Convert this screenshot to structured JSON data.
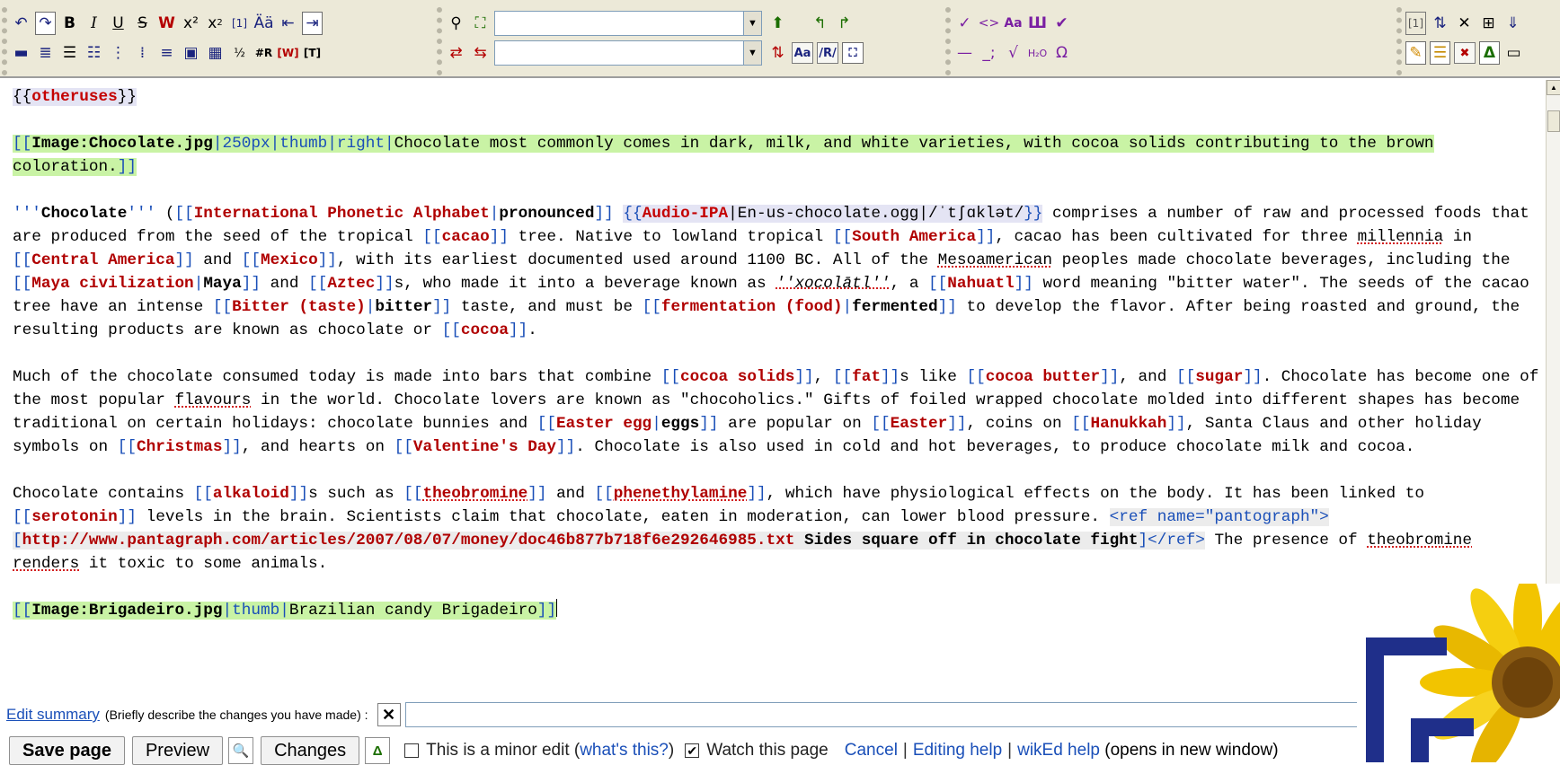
{
  "toolbar": {
    "search_value": "",
    "replace_value": ""
  },
  "editor": {
    "p1": {
      "open": "{{",
      "tpl": "otheruses",
      "close": "}}"
    },
    "p2": {
      "open": "[[",
      "target": "Image:Chocolate.jpg",
      "params": "|250px|thumb|right|",
      "caption": "Chocolate most commonly comes in dark, milk, and white varieties, with cocoa solids contributing to the brown coloration.",
      "close": "]]"
    },
    "p3": {
      "bold_open": "'''",
      "title": "Chocolate",
      "bold_close": "'''",
      "t1": " (",
      "l1_target": "International Phonetic Alphabet",
      "l1_label": "pronounced",
      "t2": " ",
      "tpl_name": "Audio-IPA",
      "tpl_args": "|En-us-chocolate.ogg|/ˈtʃɑklət/",
      "t3": " comprises a number of raw and processed foods that are produced from the seed of the tropical ",
      "l2": "cacao",
      "t4": " tree. Native to lowland tropical ",
      "l3": "South America",
      "t5": ", cacao has been cultivated for three ",
      "w_millennia": "millennia",
      "t6": " in ",
      "l4": "Central America",
      "t7": " and ",
      "l5": "Mexico",
      "t8": ", with its earliest documented used around 1100 BC. All of the ",
      "w_meso": "Mesoamerican",
      "t9": " peoples made chocolate beverages, including the ",
      "l6_target": "Maya civilization",
      "l6_label": "Maya",
      "t10": " and ",
      "l7": "Aztec",
      "t11": "s, who made it into a beverage known as ",
      "ital": "''xocolātl''",
      "t12": ", a ",
      "l8": "Nahuatl",
      "t13": " word meaning \"bitter water\". The seeds of the cacao tree have an intense ",
      "l9_target": "Bitter (taste)",
      "l9_label": "bitter",
      "t14": " taste, and must be ",
      "l10_target": "fermentation (food)",
      "l10_label": "fermented",
      "t15": " to develop the flavor. After being roasted and ground, the resulting products are known as chocolate or ",
      "l11": "cocoa",
      "t16": "."
    },
    "p4": {
      "t1": "Much of the chocolate consumed today is made into bars that combine ",
      "l1": "cocoa solids",
      "t2": ", ",
      "l2": "fat",
      "t3": "s like ",
      "l3": "cocoa butter",
      "t4": ", and ",
      "l4": "sugar",
      "t5": ". Chocolate has become one of the most popular ",
      "w_flavours": "flavours",
      "t6": " in the world. Chocolate lovers are known as \"chocoholics.\" Gifts of foiled wrapped chocolate molded into different shapes has become traditional on certain holidays: chocolate bunnies and ",
      "l5_target": "Easter egg",
      "l5_label": "eggs",
      "t7": " are popular on ",
      "l6": "Easter",
      "t8": ", coins on ",
      "l7": "Hanukkah",
      "t9": ", Santa Claus and other holiday symbols on ",
      "l8": "Christmas",
      "t10": ", and hearts on ",
      "l9": "Valentine's Day",
      "t11": ". Chocolate is also used in cold and hot beverages, to produce chocolate milk and cocoa."
    },
    "p5": {
      "t1": "Chocolate contains ",
      "l1": "alkaloid",
      "t2": "s such as ",
      "l2": "theobromine",
      "t3": " and ",
      "l3": "phenethylamine",
      "t4": ", which have physiological effects on the body. It has been linked to ",
      "l4": "serotonin",
      "t5": " levels in the brain. Scientists claim that chocolate, eaten in moderation, can lower blood pressure. ",
      "ref_open": "<ref name=\"pantograph\">",
      "ext_open": "[",
      "ext_url": "http://www.pantagraph.com/articles/2007/08/07/money/doc46b877b718f6e292646985.txt",
      "ext_label": " Sides square off in chocolate fight",
      "ext_close": "]",
      "ref_close": "</ref>",
      "t6": " The presence of ",
      "w_theo": "theobromine",
      "t7": " ",
      "w_renders": "renders",
      "t8": " it toxic to some animals."
    },
    "p6": {
      "open": "[[",
      "target": "Image:Brigadeiro.jpg",
      "params": "|thumb|",
      "caption": "Brazilian candy Brigadeiro",
      "close": "]]"
    }
  },
  "summary": {
    "link": "Edit summary",
    "hint": "(Briefly describe the changes you have made) :",
    "value": ""
  },
  "buttons": {
    "save": "Save page",
    "preview": "Preview",
    "changes": "Changes",
    "minor_label": "This is a minor edit (",
    "minor_link": "what's this?",
    "minor_close": ")",
    "minor_checked": false,
    "watch_label": "Watch this page",
    "watch_checked": true,
    "cancel": "Cancel",
    "sep": "|",
    "editing_help": "Editing help",
    "wiked_help": "wikEd help",
    "opens": "(opens in new window)"
  }
}
